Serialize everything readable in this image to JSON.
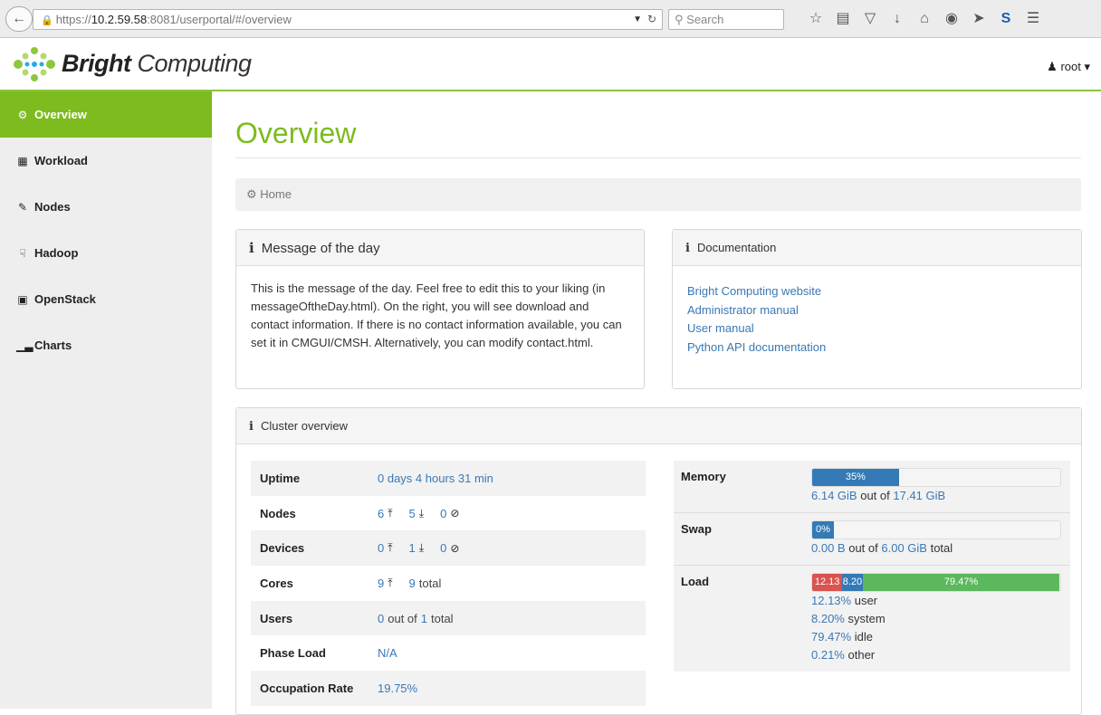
{
  "browser": {
    "url_prefix": "https://",
    "url_host": "10.2.59.58",
    "url_rest": ":8081/userportal/#/overview",
    "search_placeholder": "Search"
  },
  "header": {
    "brand_bold": "Bright",
    "brand_light": "Computing",
    "user": "root"
  },
  "sidebar": {
    "items": [
      {
        "label": "Overview",
        "icon": "dashboard-icon"
      },
      {
        "label": "Workload",
        "icon": "table-icon"
      },
      {
        "label": "Nodes",
        "icon": "edit-icon"
      },
      {
        "label": "Hadoop",
        "icon": "hand-icon"
      },
      {
        "label": "OpenStack",
        "icon": "stop-icon"
      },
      {
        "label": "Charts",
        "icon": "bar-chart-icon"
      }
    ]
  },
  "main": {
    "title": "Overview",
    "breadcrumb": "Home",
    "motd": {
      "title": "Message of the day",
      "text": "This is the message of the day. Feel free to edit this to your liking (in messageOftheDay.html). On the right, you will see download and contact information. If there is no contact information available, you can set it in CMGUI/CMSH. Alternatively, you can modify contact.html."
    },
    "docs": {
      "title": "Documentation",
      "links": [
        "Bright Computing website",
        "Administrator manual",
        "User manual",
        "Python API documentation"
      ]
    },
    "cluster": {
      "title": "Cluster overview",
      "uptime_label": "Uptime",
      "uptime": "0 days 4 hours 31 min",
      "nodes_label": "Nodes",
      "nodes": [
        "6",
        "5",
        "0"
      ],
      "devices_label": "Devices",
      "devices": [
        "0",
        "1",
        "0"
      ],
      "cores_label": "Cores",
      "cores_up": "9",
      "cores_total": "9",
      "total_word": "total",
      "users_label": "Users",
      "users_active": "0",
      "users_out_of": "out of",
      "users_total": "1",
      "phase_label": "Phase Load",
      "phase": "N/A",
      "occupation_label": "Occupation Rate",
      "occupation": "19.75%",
      "memory_label": "Memory",
      "memory_pct": 35,
      "memory_pct_text": "35%",
      "memory_used": "6.14 GiB",
      "memory_total": "17.41 GiB",
      "out_of": "out of",
      "swap_label": "Swap",
      "swap_pct": 0,
      "swap_pct_text": "0%",
      "swap_used": "0.00 B",
      "swap_total": "6.00 GiB",
      "load_label": "Load",
      "load_user": 12.13,
      "load_system": 8.2,
      "load_idle": 79.47,
      "load_user_bar": "12.13",
      "load_system_bar": "8.20",
      "load_idle_bar": "79.47%",
      "load_user_text": "12.13%",
      "load_system_text": "8.20%",
      "load_idle_text": "79.47%",
      "load_other_text": "0.21%",
      "user_word": "user",
      "system_word": "system",
      "idle_word": "idle",
      "other_word": "other"
    }
  }
}
